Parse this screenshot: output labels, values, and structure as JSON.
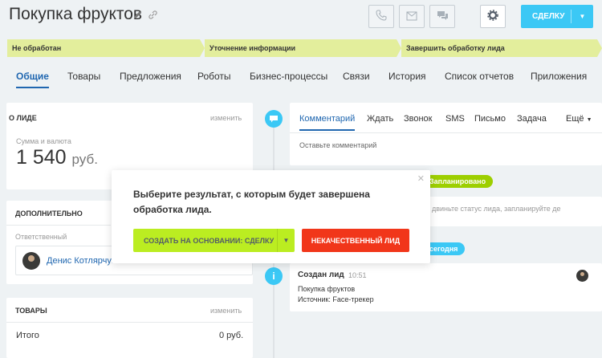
{
  "header": {
    "title": "Покупка фруктов",
    "convert_label": "СДЕЛКУ"
  },
  "stages": [
    "Не обработан",
    "Уточнение информации",
    "Завершить обработку лида"
  ],
  "tabs": [
    "Общие",
    "Товары",
    "Предложения",
    "Роботы",
    "Бизнес-процессы",
    "Связи",
    "История",
    "Список отчетов",
    "Приложения"
  ],
  "about": {
    "heading": "О ЛИДЕ",
    "edit": "изменить",
    "amount_label": "Сумма и валюта",
    "amount": "1 540",
    "currency": "руб."
  },
  "additional": {
    "heading": "ДОПОЛНИТЕЛЬНО",
    "responsible_label": "Ответственный",
    "responsible_name": "Денис Котлярчук"
  },
  "products": {
    "heading": "ТОВАРЫ",
    "edit": "изменить",
    "total_label": "Итого",
    "total_value": "0 руб."
  },
  "editor": {
    "tabs": [
      "Комментарий",
      "Ждать",
      "Звонок",
      "SMS",
      "Письмо",
      "Задача",
      "Ещё"
    ],
    "placeholder": "Оставьте комментарий"
  },
  "timeline": {
    "planned_badge": "Запланировано",
    "planned_text": "двиньте статус лида, запланируйте де",
    "today_badge": "сегодня",
    "event_title": "Создан лид",
    "event_time": "10:51",
    "event_line1": "Покупка фруктов",
    "event_line2": "Источник: Face-трекер"
  },
  "popup": {
    "text": "Выберите результат, с которым будет завершена обработка лида.",
    "create_label": "СОЗДАТЬ НА ОСНОВАНИИ: СДЕЛКУ",
    "junk_label": "НЕКАЧЕСТВЕННЫЙ ЛИД"
  },
  "colors": {
    "accent_blue": "#2067b0",
    "button_blue": "#3bc8f5",
    "stage_green": "#e3ee9c",
    "button_green": "#bbed21",
    "button_red": "#f1361a"
  }
}
